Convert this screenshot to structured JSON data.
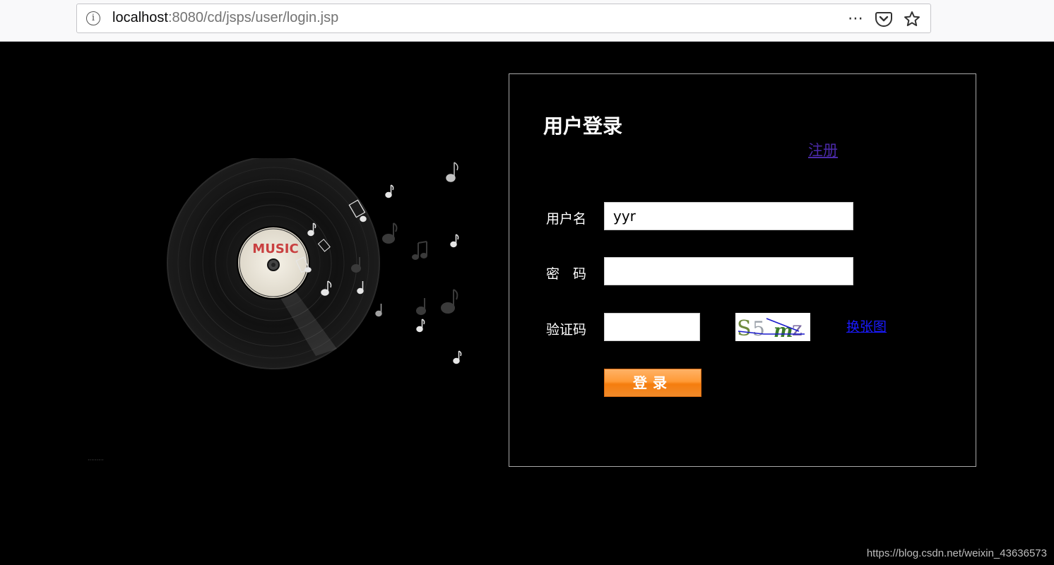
{
  "browser": {
    "url_host": "localhost",
    "url_rest": ":8080/cd/jsps/user/login.jsp",
    "more_icon": "⋯",
    "icons": [
      "info-icon",
      "more-icon",
      "pocket-icon",
      "star-icon"
    ]
  },
  "vinyl": {
    "label_text": "MUSIC",
    "label_color": "#c94040"
  },
  "login": {
    "title": "用户登录",
    "register_link": "注册",
    "username_label": "用户名",
    "password_label": "密　码",
    "captcha_label": "验证码",
    "username_value": "yyr",
    "password_value": "",
    "captcha_value": "",
    "captcha_text": "S5mz",
    "swap_link": "换张图",
    "submit_label": "登录"
  },
  "watermark": "https://blog.csdn.net/weixin_43636573",
  "colors": {
    "background": "#000000",
    "button_orange": "#f08a2a",
    "register_link": "#4b2aa8",
    "swap_link": "#1a1aff"
  }
}
